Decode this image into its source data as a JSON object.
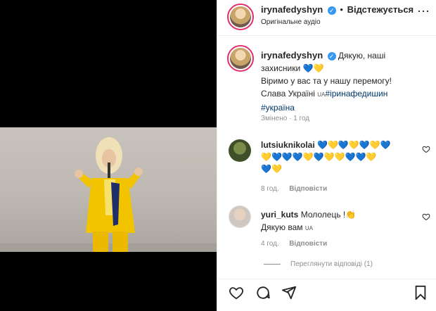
{
  "header": {
    "username": "irynafedyshyn",
    "follow_label": "Відстежується",
    "audio": "Оригінальне аудіо",
    "separator": "•",
    "more": "⋯"
  },
  "caption": {
    "username": "irynafedyshyn",
    "line1": "Дякую, наші",
    "line2": "захисники 💙💛",
    "line3": "Віримо у вас та у нашу перемогу!",
    "line4_prefix": "Слава Україні ",
    "flag": "UA",
    "hashtag1": "#іринафедишин",
    "hashtag2": "#україна",
    "edited": "Змінено · 1 год"
  },
  "comments": [
    {
      "username": "lutsiuknikolai",
      "text_line1": "💙💛💙💛💙💛💙",
      "text_line2": "💛💙💙💙💛💙💛💛💙💙💛",
      "text_line3": "💙💛",
      "time": "8 год.",
      "reply": "Відповісти"
    },
    {
      "username": "yuri_kuts",
      "text_line1": "Мололець !👏",
      "text_line2_prefix": "Дякую вам ",
      "flag": "UA",
      "time": "4 год.",
      "reply": "Відповісти",
      "view_replies": "Переглянути відповіді (1)"
    }
  ],
  "actions": {
    "like": "heart-icon",
    "comment": "comment-icon",
    "share": "share-icon",
    "save": "bookmark-icon"
  },
  "colors": {
    "accent": "#3897f0",
    "link": "#00376b",
    "suit": "#f2c400"
  }
}
